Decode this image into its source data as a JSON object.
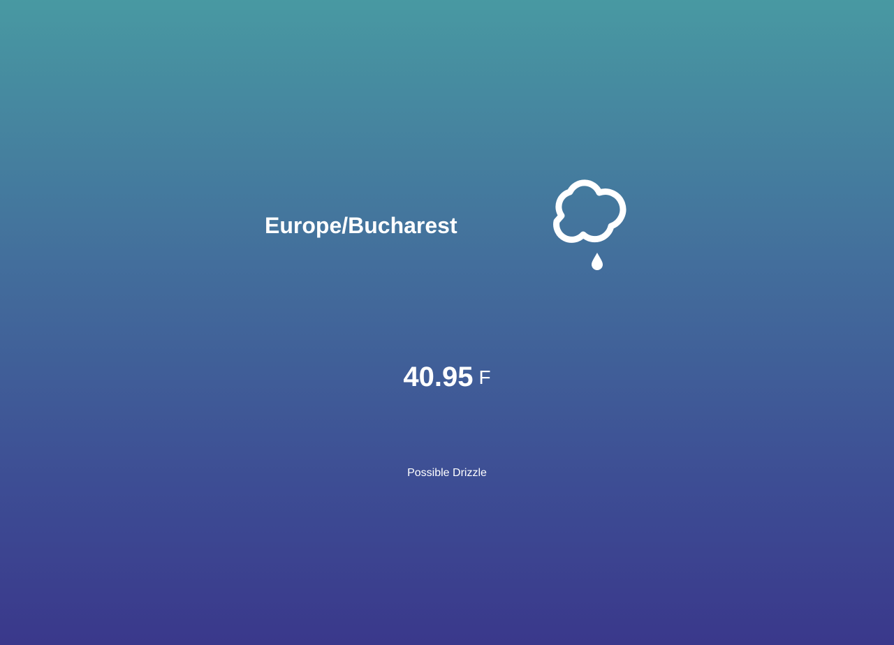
{
  "location": {
    "timezone": "Europe/Bucharest"
  },
  "weather": {
    "icon": "rain-icon",
    "temperature_value": "40.95",
    "temperature_unit": "F",
    "summary": "Possible Drizzle"
  },
  "colors": {
    "gradient_top": "#4899a2",
    "gradient_bottom": "#3a388b",
    "text": "#ffffff"
  }
}
